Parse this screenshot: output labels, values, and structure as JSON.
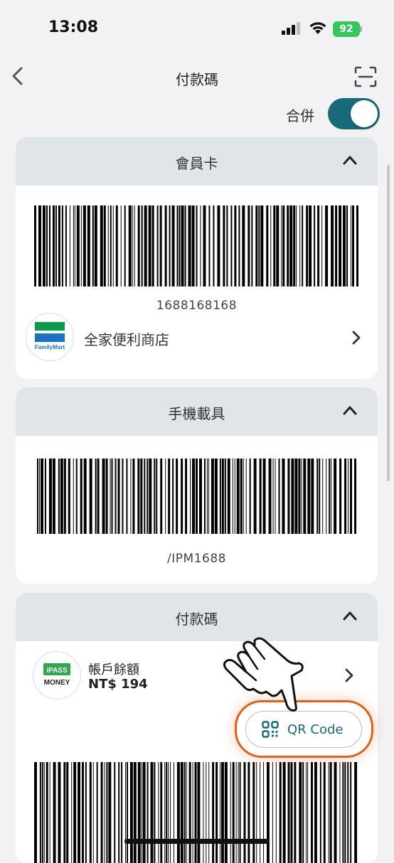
{
  "status": {
    "time": "13:08",
    "battery": "92"
  },
  "nav": {
    "title": "付款碼"
  },
  "merge": {
    "label": "合併",
    "enabled": true
  },
  "cards": {
    "member": {
      "title": "會員卡",
      "barcode_number": "1688168168",
      "store_name": "全家便利商店",
      "store_logo_text": "FamilyMart"
    },
    "carrier": {
      "title": "手機載具",
      "barcode_number": "/IPM1688"
    },
    "payment": {
      "title": "付款碼",
      "balance_label": "帳戶餘額",
      "balance_value": "NT$ 194",
      "wallet_logo_line1": "iPASS",
      "wallet_logo_line2": "MONEY",
      "qr_button_label": "QR Code"
    }
  },
  "colors": {
    "accent": "#196a78",
    "highlight": "#e0601c",
    "card_header": "#dfe5e8",
    "family_green": "#0a9b48",
    "family_blue": "#1a72c6"
  }
}
